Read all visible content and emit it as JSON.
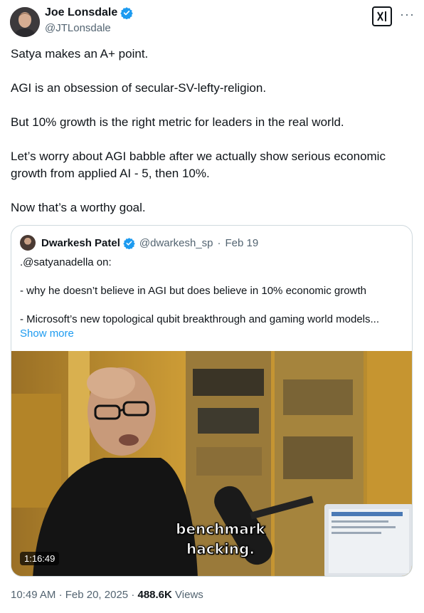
{
  "author": {
    "display_name": "Joe Lonsdale",
    "handle": "@JTLonsdale"
  },
  "header_icons": {
    "grok": "grok-icon",
    "more": "more-icon",
    "more_glyph": "···"
  },
  "tweet": {
    "paragraphs": [
      "Satya makes an A+ point.",
      "AGI is an obsession of secular-SV-lefty-religion.",
      "But 10% growth is the right metric for leaders in the real world.",
      "Let’s worry about AGI babble after we actually show serious economic growth from applied AI - 5, then 10%.",
      "Now that’s a worthy goal."
    ]
  },
  "quote": {
    "display_name": "Dwarkesh Patel",
    "handle": "@dwarkesh_sp",
    "separator": "·",
    "date": "Feb 19",
    "lines": [
      ".@satyanadella on:",
      "- why he doesn’t believe in AGI but does believe in 10% economic growth",
      "- Microsoft’s new topological qubit breakthrough and gaming world models..."
    ],
    "show_more": "Show more",
    "video": {
      "caption": "benchmark\nhacking.",
      "duration": "1:16:49"
    }
  },
  "footer": {
    "time": "10:49 AM",
    "separator": "·",
    "date": "Feb 20, 2025",
    "separator2": "·",
    "views_count": "488.6K",
    "views_label": "Views"
  },
  "colors": {
    "verified": "#1d9bf0",
    "link": "#1d9bf0",
    "secondary": "#536471"
  }
}
